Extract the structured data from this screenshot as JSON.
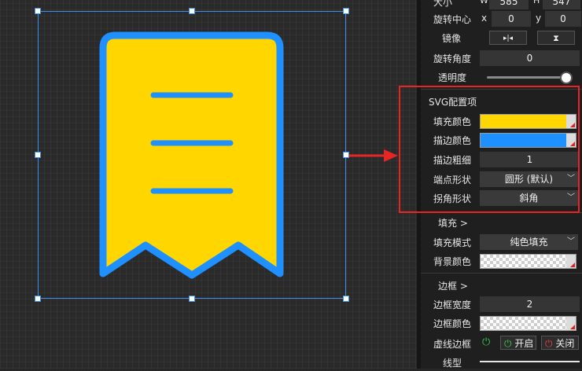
{
  "size": {
    "w_label": "W",
    "w_value": "585",
    "h_label": "H",
    "h_value": "547",
    "label": "大小"
  },
  "rotation_center": {
    "label": "旋转中心",
    "x_label": "x",
    "x_value": "0",
    "y_label": "y",
    "y_value": "0"
  },
  "mirror": {
    "label": "镜像",
    "horizontal_glyph": "▸|◂",
    "vertical_glyph": "⧗"
  },
  "rotation_angle": {
    "label": "旋转角度",
    "value": "0"
  },
  "opacity": {
    "label": "透明度",
    "level": 1.0
  },
  "svg_config": {
    "title": "SVG配置项",
    "fill_color": {
      "label": "填充颜色",
      "color": "#FFD600"
    },
    "stroke_color": {
      "label": "描边颜色",
      "color": "#1E90FF"
    },
    "stroke_width": {
      "label": "描边粗细",
      "value": "1"
    },
    "linecap": {
      "label": "端点形状",
      "value": "圆形 (默认)"
    },
    "linejoin": {
      "label": "拐角形状",
      "value": "斜角"
    }
  },
  "fill_section": {
    "title": "填充 >",
    "mode": {
      "label": "填充模式",
      "value": "纯色填充"
    },
    "bg_color": {
      "label": "背景颜色"
    }
  },
  "border_section": {
    "title": "边框 >",
    "width": {
      "label": "边框宽度",
      "value": "2"
    },
    "color": {
      "label": "边框颜色"
    },
    "dashed": {
      "label": "虚线边框",
      "on_label": "开启",
      "off_label": "关闭"
    },
    "line_type": {
      "label": "线型"
    }
  },
  "colors": {
    "accent": "#3D8EF0",
    "highlight_red": "#E82525",
    "icon_fill": "#FFD600",
    "icon_stroke": "#1E90FF",
    "power_on": "#3CC24A",
    "power_off": "#E04040"
  }
}
